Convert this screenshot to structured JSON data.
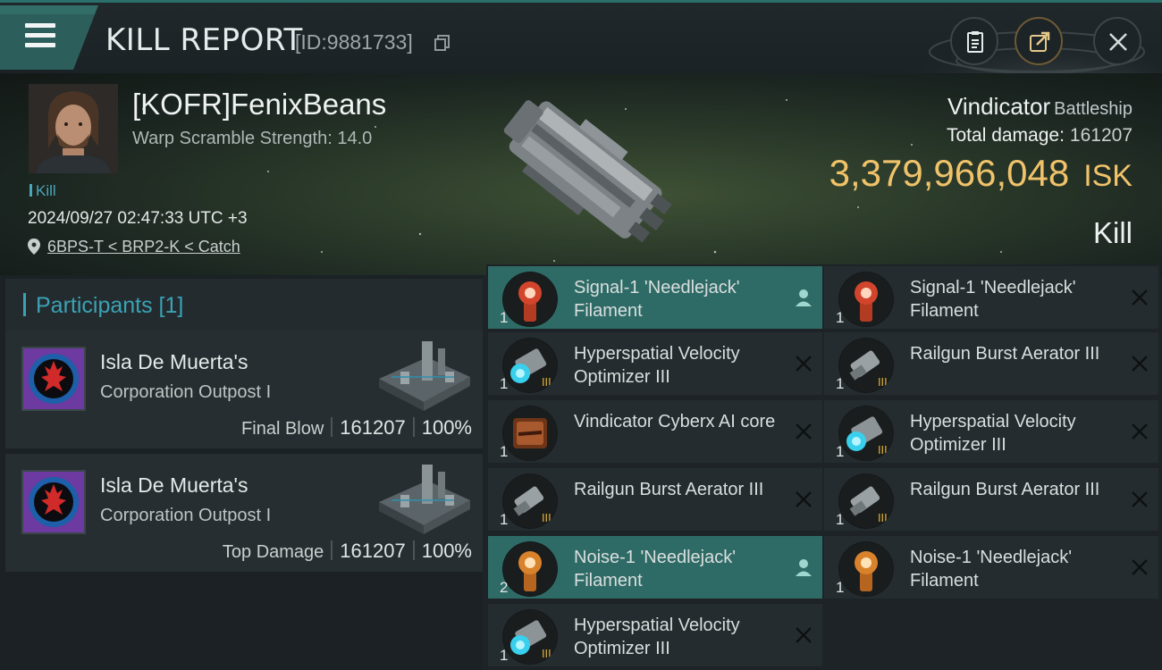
{
  "header": {
    "title": "KILL REPORT",
    "id_label": "[ID:9881733]",
    "buttons": [
      "clipboard-icon",
      "share-icon",
      "close-icon"
    ]
  },
  "victim": {
    "pilot": "[KOFR]FenixBeans",
    "subtitle": "Warp Scramble Strength: 14.0",
    "tag": "Kill",
    "timestamp": "2024/09/27 02:47:33 UTC +3",
    "location": "6BPS-T < BRP2-K < Catch",
    "ship_name": "Vindicator",
    "ship_class": "Battleship",
    "total_damage_label": "Total damage:",
    "total_damage": "161207",
    "isk_value": "3,379,966,048",
    "isk_unit": "ISK",
    "result": "Kill"
  },
  "participants": {
    "title": "Participants [1]",
    "list": [
      {
        "name": "Isla De Muerta's",
        "type": "Corporation Outpost I",
        "role": "Final Blow",
        "damage": "161207",
        "percent": "100%"
      },
      {
        "name": "Isla De Muerta's",
        "type": "Corporation Outpost I",
        "role": "Top Damage",
        "damage": "161207",
        "percent": "100%"
      }
    ]
  },
  "items": {
    "left": [
      {
        "qty": "1",
        "name": "Signal-1 'Needlejack' Filament",
        "icon": "filament-red-icon",
        "state": "dropped"
      },
      {
        "qty": "1",
        "name": "Hyperspatial Velocity Optimizer III",
        "icon": "rig-cyan-icon",
        "state": "destroyed"
      },
      {
        "qty": "1",
        "name": "Vindicator Cyberx AI core",
        "icon": "ai-core-icon",
        "state": "destroyed"
      },
      {
        "qty": "1",
        "name": "Railgun Burst Aerator III",
        "icon": "rig-gray-icon",
        "state": "destroyed"
      },
      {
        "qty": "2",
        "name": "Noise-1 'Needlejack' Filament",
        "icon": "filament-orange-icon",
        "state": "dropped"
      },
      {
        "qty": "1",
        "name": "Hyperspatial Velocity Optimizer III",
        "icon": "rig-cyan-icon",
        "state": "destroyed"
      }
    ],
    "right": [
      {
        "qty": "1",
        "name": "Signal-1 'Needlejack' Filament",
        "icon": "filament-red-icon",
        "state": "destroyed"
      },
      {
        "qty": "1",
        "name": "Railgun Burst Aerator III",
        "icon": "rig-gray-icon",
        "state": "destroyed"
      },
      {
        "qty": "1",
        "name": "Hyperspatial Velocity Optimizer III",
        "icon": "rig-cyan-icon",
        "state": "destroyed"
      },
      {
        "qty": "1",
        "name": "Railgun Burst Aerator III",
        "icon": "rig-gray-icon",
        "state": "destroyed"
      },
      {
        "qty": "1",
        "name": "Noise-1 'Needlejack' Filament",
        "icon": "filament-orange-icon",
        "state": "destroyed"
      }
    ]
  },
  "colors": {
    "accent": "#3ba2b5",
    "isk": "#f0c36a",
    "selected_row": "#2f6b66"
  }
}
